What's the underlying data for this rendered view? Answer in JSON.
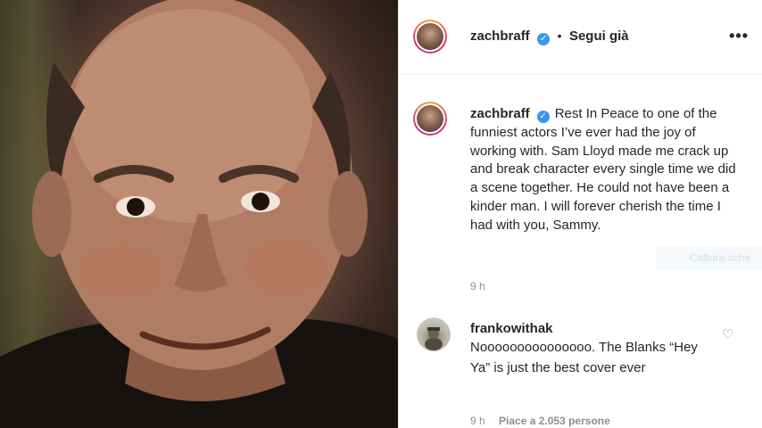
{
  "post": {
    "author": "zachbraff",
    "follow_status": "Segui già",
    "dot": "•",
    "more": "•••",
    "caption": "Rest In Peace to one of the funniest actors I’ve ever had the joy of working with. Sam Lloyd made me crack up and break character every single time we did a scene together. He could not have been a kinder man. I will forever cherish the time I had with you, Sammy.",
    "caption_time": "9 h",
    "tooltip": "Cattura sche"
  },
  "comment": {
    "author": "frankowithak",
    "text": "Nooooooooooooooo. The Blanks “Hey Ya” is just the best cover ever",
    "time": "9 h",
    "likes": "Piace a 2.053 persone"
  },
  "icons": {
    "verified": "verified-badge-icon",
    "heart": "heart-icon",
    "more": "more-options-icon"
  },
  "colors": {
    "verified": "#3897f0",
    "text": "#262626",
    "muted": "#8e8e8e"
  }
}
